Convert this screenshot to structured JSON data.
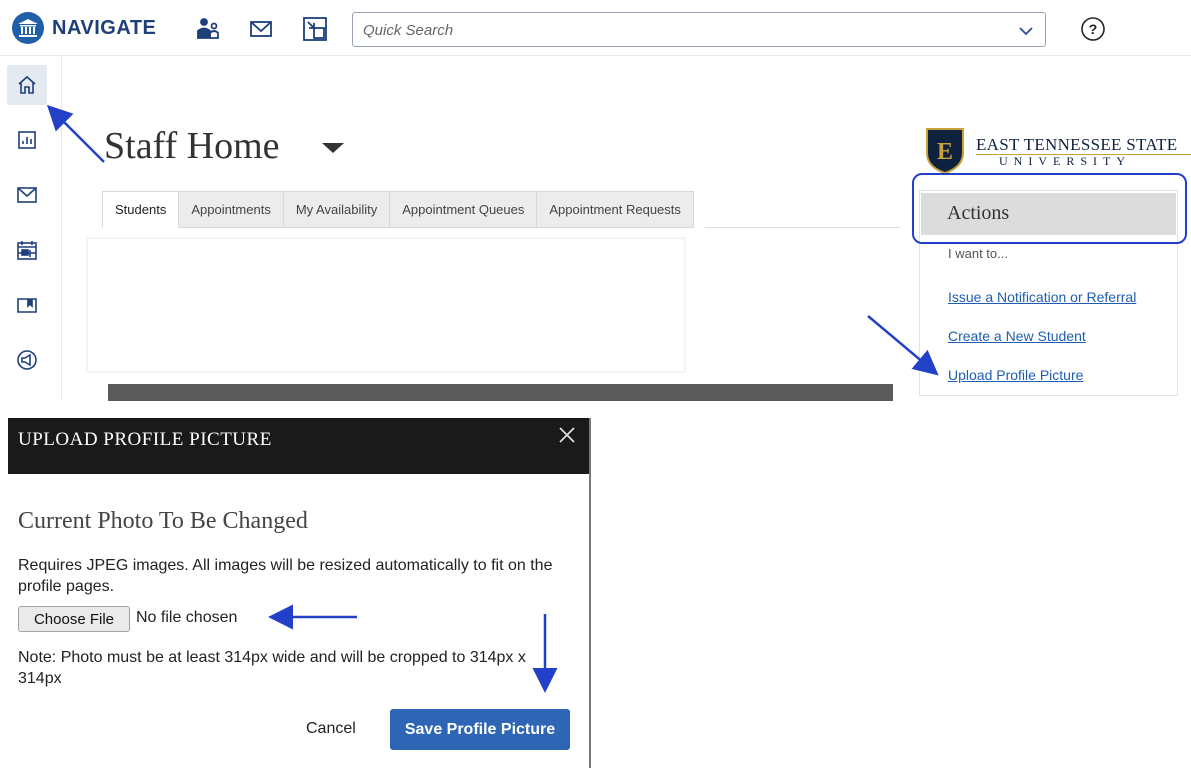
{
  "header": {
    "brand": "NAVIGATE",
    "search_placeholder": "Quick Search",
    "icons": [
      "university-icon",
      "users-icon",
      "mail-icon",
      "split-window-icon",
      "chevron-down-icon",
      "help-icon"
    ]
  },
  "sidebar": {
    "items": [
      {
        "name": "home-icon",
        "active": true
      },
      {
        "name": "reports-icon",
        "active": false
      },
      {
        "name": "mail-icon",
        "active": false
      },
      {
        "name": "calendar-icon",
        "active": false
      },
      {
        "name": "folder-icon",
        "active": false
      },
      {
        "name": "megaphone-icon",
        "active": false
      }
    ]
  },
  "main": {
    "page_title": "Staff Home",
    "tabs": [
      {
        "label": "Students",
        "active": true
      },
      {
        "label": "Appointments",
        "active": false
      },
      {
        "label": "My Availability",
        "active": false
      },
      {
        "label": "Appointment Queues",
        "active": false
      },
      {
        "label": "Appointment Requests",
        "active": false
      }
    ]
  },
  "institution": {
    "name": "EAST TENNESSEE STATE",
    "subtitle": "UNIVERSITY",
    "shield_letter": "E"
  },
  "actions": {
    "title": "Actions",
    "intro": "I want to...",
    "links": [
      "Issue a Notification or Referral",
      "Create a New Student",
      "Upload Profile Picture"
    ]
  },
  "modal": {
    "title": "UPLOAD PROFILE PICTURE",
    "subtitle": "Current Photo To Be Changed",
    "description": "Requires JPEG images. All images will be resized automatically to fit on the profile pages.",
    "choose_file_label": "Choose File",
    "no_file_text": "No file chosen",
    "note": "Note: Photo must be at least 314px wide and will be cropped to 314px x 314px",
    "cancel_label": "Cancel",
    "save_label": "Save Profile Picture"
  },
  "colors": {
    "brand": "#1e5fa8",
    "link": "#1f5fb0",
    "annotation": "#2340c8",
    "save_button": "#2e66b5",
    "modal_header": "#1a1a1a"
  }
}
